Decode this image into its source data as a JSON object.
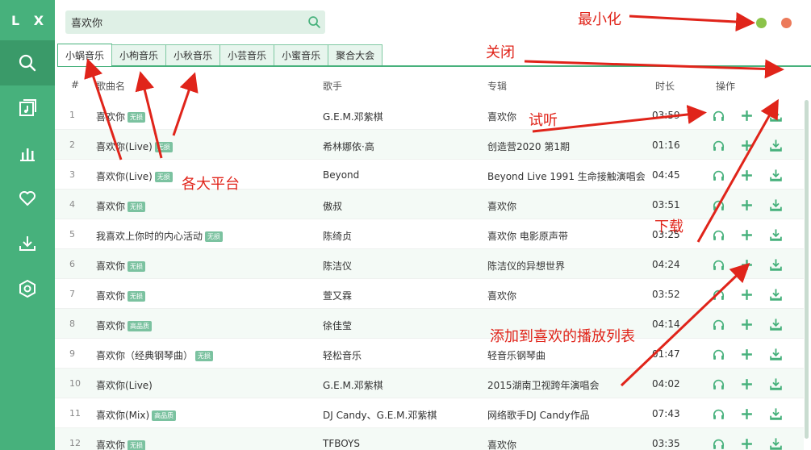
{
  "app": {
    "logo": "L X"
  },
  "sidebar": {
    "items": [
      {
        "icon": "search-icon"
      },
      {
        "icon": "music-list-icon"
      },
      {
        "icon": "chart-icon"
      },
      {
        "icon": "heart-icon"
      },
      {
        "icon": "download-icon"
      },
      {
        "icon": "settings-icon"
      }
    ]
  },
  "search": {
    "value": "喜欢你",
    "placeholder": ""
  },
  "tabs": [
    {
      "label": "小蜗音乐"
    },
    {
      "label": "小枸音乐"
    },
    {
      "label": "小秋音乐"
    },
    {
      "label": "小芸音乐"
    },
    {
      "label": "小蜜音乐"
    },
    {
      "label": "聚合大会"
    }
  ],
  "table": {
    "headers": {
      "index": "#",
      "name": "歌曲名",
      "singer": "歌手",
      "album": "专辑",
      "duration": "时长",
      "actions": "操作"
    },
    "rows": [
      {
        "index": "1",
        "name": "喜欢你",
        "badge": "无损",
        "singer": "G.E.M.邓紫棋",
        "album": "喜欢你",
        "duration": "03:59"
      },
      {
        "index": "2",
        "name": "喜欢你(Live)",
        "badge": "无损",
        "singer": "希林娜依·高",
        "album": "创造营2020 第1期",
        "duration": "01:16"
      },
      {
        "index": "3",
        "name": "喜欢你(Live)",
        "badge": "无损",
        "singer": "Beyond",
        "album": "Beyond Live 1991 生命接触演唱会",
        "duration": "04:45"
      },
      {
        "index": "4",
        "name": "喜欢你",
        "badge": "无损",
        "singer": "傲叔",
        "album": "喜欢你",
        "duration": "03:51"
      },
      {
        "index": "5",
        "name": "我喜欢上你时的内心活动",
        "badge": "无损",
        "singer": "陈绮贞",
        "album": "喜欢你 电影原声带",
        "duration": "03:25"
      },
      {
        "index": "6",
        "name": "喜欢你",
        "badge": "无损",
        "singer": "陈洁仪",
        "album": "陈洁仪的异想世界",
        "duration": "04:24"
      },
      {
        "index": "7",
        "name": "喜欢你",
        "badge": "无损",
        "singer": "萱又霖",
        "album": "喜欢你",
        "duration": "03:52"
      },
      {
        "index": "8",
        "name": "喜欢你",
        "badge": "高品质",
        "singer": "徐佳莹",
        "album": "",
        "duration": "04:14"
      },
      {
        "index": "9",
        "name": "喜欢你（经典钢琴曲）",
        "badge": "无损",
        "singer": "轻松音乐",
        "album": "轻音乐钢琴曲",
        "duration": "01:47"
      },
      {
        "index": "10",
        "name": "喜欢你(Live)",
        "badge": "",
        "singer": "G.E.M.邓紫棋",
        "album": "2015湖南卫视跨年演唱会",
        "duration": "04:02"
      },
      {
        "index": "11",
        "name": "喜欢你(Mix)",
        "badge": "高品质",
        "singer": "DJ Candy、G.E.M.邓紫棋",
        "album": "网络歌手DJ Candy作品",
        "duration": "07:43"
      },
      {
        "index": "12",
        "name": "喜欢你",
        "badge": "无损",
        "singer": "TFBOYS",
        "album": "喜欢你",
        "duration": "03:35"
      }
    ]
  },
  "annotations": {
    "minimize": "最小化",
    "close": "关闭",
    "listen": "试听",
    "platforms": "各大平台",
    "download": "下载",
    "add_favorite": "添加到喜欢的播放列表"
  },
  "colors": {
    "accent": "#47b17c",
    "annotation": "#e0241a",
    "minimize": "#8bc34a",
    "close": "#ec7a5a"
  }
}
